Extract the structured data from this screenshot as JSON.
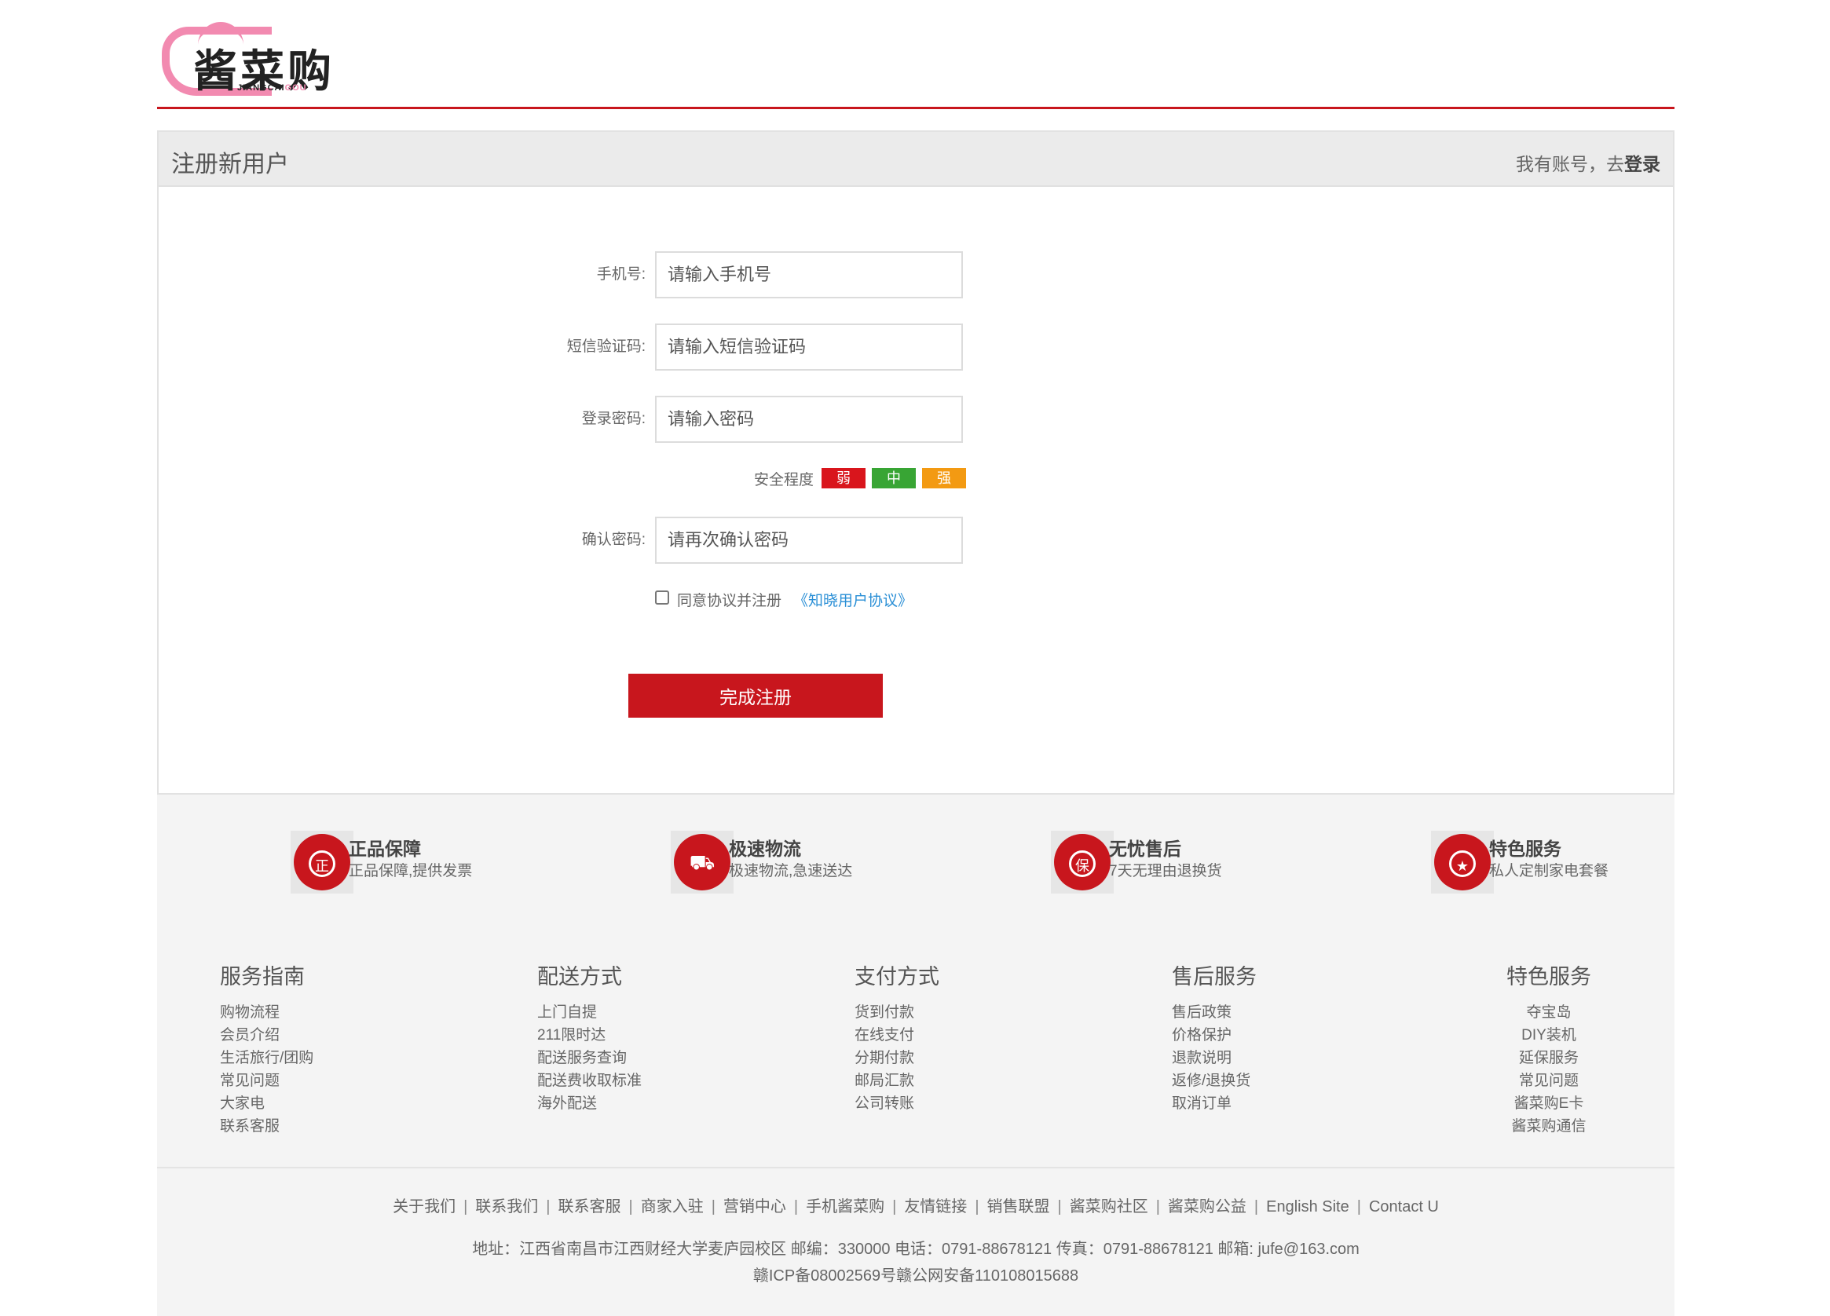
{
  "brand": {
    "logo_text": "酱菜购",
    "logo_sub_a": "JIANGCAI",
    "logo_sub_b": "GOU",
    "accent": "#c8161d",
    "pink": "#f28ab0"
  },
  "register": {
    "title": "注册新用户",
    "login_prompt": "我有账号，去",
    "login_link": "登录",
    "fields": [
      {
        "label": "手机号:",
        "placeholder": "请输入手机号"
      },
      {
        "label": "短信验证码:",
        "placeholder": "请输入短信验证码"
      },
      {
        "label": "登录密码:",
        "placeholder": "请输入密码"
      },
      {
        "label": "确认密码:",
        "placeholder": "请再次确认密码"
      }
    ],
    "strength": {
      "label": "安全程度",
      "levels": [
        {
          "text": "弱",
          "color": "#d9151c"
        },
        {
          "text": "中",
          "color": "#38a534"
        },
        {
          "text": "强",
          "color": "#f39a12"
        }
      ]
    },
    "agree_text": "同意协议并注册",
    "agree_link": "《知晓用户协议》",
    "submit": "完成注册"
  },
  "features": [
    {
      "icon": "genuine-icon",
      "glyph": "正",
      "title": "正品保障",
      "desc": "正品保障,提供发票"
    },
    {
      "icon": "truck-icon",
      "glyph": "⛟",
      "title": "极速物流",
      "desc": "极速物流,急速送达"
    },
    {
      "icon": "shield-icon",
      "glyph": "保",
      "title": "无忧售后",
      "desc": "7天无理由退换货"
    },
    {
      "icon": "award-icon",
      "glyph": "★",
      "title": "特色服务",
      "desc": "私人定制家电套餐"
    }
  ],
  "footer_columns": [
    {
      "title": "服务指南",
      "items": [
        "购物流程",
        "会员介绍",
        "生活旅行/团购",
        "常见问题",
        "大家电",
        "联系客服"
      ]
    },
    {
      "title": "配送方式",
      "items": [
        "上门自提",
        "211限时达",
        "配送服务查询",
        "配送费收取标准",
        "海外配送"
      ]
    },
    {
      "title": "支付方式",
      "items": [
        "货到付款",
        "在线支付",
        "分期付款",
        "邮局汇款",
        "公司转账"
      ]
    },
    {
      "title": "售后服务",
      "items": [
        "售后政策",
        "价格保护",
        "退款说明",
        "返修/退换货",
        "取消订单"
      ]
    },
    {
      "title": "特色服务",
      "items": [
        "夺宝岛",
        "DIY装机",
        "延保服务",
        "常见问题",
        "酱菜购E卡",
        "酱菜购通信"
      ]
    }
  ],
  "bottom_links": [
    "关于我们",
    "联系我们",
    "联系客服",
    "商家入驻",
    "营销中心",
    "手机酱菜购",
    "友情链接",
    "销售联盟",
    "酱菜购社区",
    "酱菜购公益",
    "English Site",
    "Contact U"
  ],
  "address": "地址：江西省南昌市江西财经大学麦庐园校区 邮编：330000 电话：0791-88678121 传真：0791-88678121 邮箱: jufe@163.com",
  "icp": "赣ICP备08002569号赣公网安备110108015688"
}
